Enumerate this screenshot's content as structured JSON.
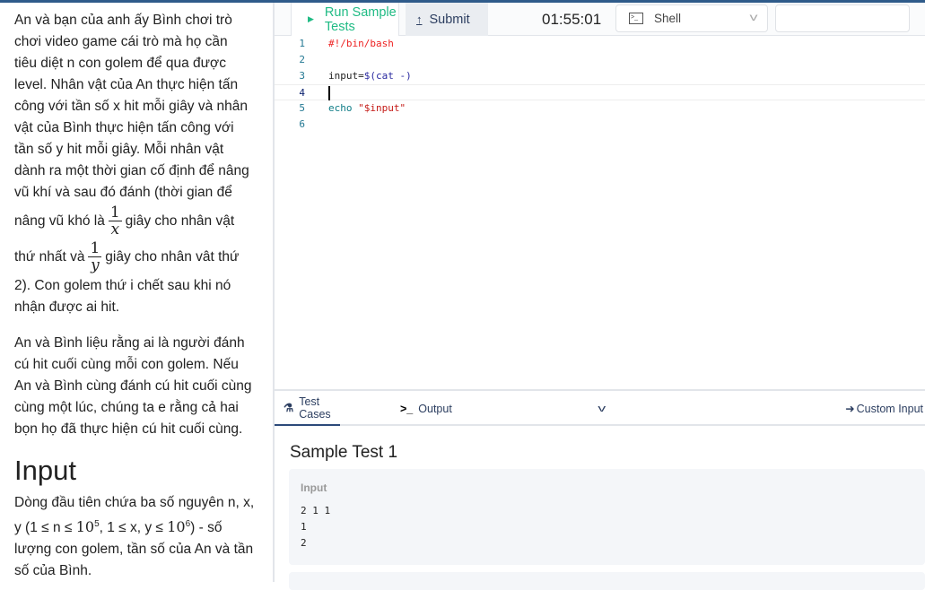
{
  "problem": {
    "p1_lines": [
      "An và bạn của anh ấy Bình chơi trò",
      "chơi video game cái trò mà họ cần",
      "tiêu diệt n con golem để qua được",
      "level. Nhân vật của An thực hiện tấn",
      "công với tần số x hit mỗi giây và nhân",
      "vật của Bình thực hiện tấn công với",
      "tần số y hit mỗi giây. Mỗi nhân vật",
      "dành ra một thời gian cố định để nâng",
      "vũ khí và sau đó đánh (thời gian để"
    ],
    "frac1_pre": "nâng vũ khó là",
    "frac1_num": "1",
    "frac1_den": "x",
    "frac1_post": "giây cho nhân vật",
    "frac2_pre": "thứ nhất và",
    "frac2_num": "1",
    "frac2_den": "y",
    "frac2_post": "giây cho nhân vât thứ",
    "p1_end": [
      "2). Con golem thứ i chết sau khi nó",
      "nhận được ai hit."
    ],
    "p2_lines": [
      "An và Bình liệu rằng ai là người đánh",
      "cú hit cuối cùng mỗi con golem. Nếu",
      "An và Bình cùng đánh cú hit cuối cùng",
      "cùng một lúc, chúng ta e rằng cả hai",
      "bọn họ đã thực hiện cú hit cuối cùng."
    ],
    "input_heading": "Input",
    "input_l1": "Dòng đầu tiên chứa ba số nguyên n, x,",
    "input_l2a": "y (1 ≤ n ≤ ",
    "input_l2b": "10",
    "input_l2c": "5",
    "input_l2d": ", 1 ≤ x, y ≤ ",
    "input_l2e": "10",
    "input_l2f": "6",
    "input_l2g": ") - số",
    "input_l3": "lượng con golem, tần số của An và tần",
    "input_l4": "số của Bình."
  },
  "toolbar": {
    "run_label": "Run Sample Tests",
    "submit_label": "Submit",
    "timer": "01:55:01",
    "language": "Shell",
    "run_icon": "play-icon",
    "submit_icon": "upload-icon",
    "lang_icon": "terminal-icon"
  },
  "editor": {
    "lines": [
      {
        "n": "1",
        "code": "#!/bin/bash"
      },
      {
        "n": "2",
        "code": ""
      },
      {
        "n": "3",
        "code": "input=$(cat -)"
      },
      {
        "n": "4",
        "code": ""
      },
      {
        "n": "5",
        "code": "echo \"$input\""
      },
      {
        "n": "6",
        "code": ""
      }
    ]
  },
  "bottom": {
    "tabs": [
      "Test Cases",
      "Output"
    ],
    "custom_input": "Custom Input",
    "sample_title": "Sample Test 1",
    "input_label": "Input",
    "input_value": "2 1 1\n1\n2"
  },
  "colors": {
    "accent": "#1fbb84",
    "navy": "#2c3e60",
    "comment": "#e22",
    "string": "#c41a16"
  }
}
